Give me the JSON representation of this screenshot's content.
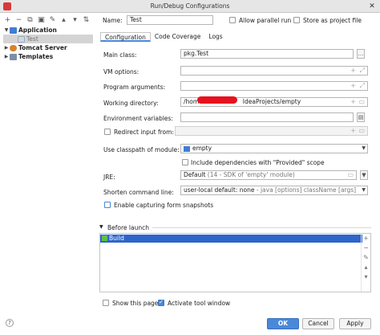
{
  "window": {
    "title": "Run/Debug Configurations"
  },
  "toolbar": {
    "add": "+",
    "remove": "−",
    "copy": "⧉",
    "save": "▣",
    "edit": "✎",
    "move_up": "▴",
    "move_down": "▾",
    "sort": "⇅"
  },
  "tree": {
    "application": "Application",
    "test": "Test",
    "tomcat": "Tomcat Server",
    "templates": "Templates"
  },
  "header": {
    "name_label": "Name:",
    "name_value": "Test",
    "parallel_label": "Allow parallel run",
    "store_label": "Store as project file"
  },
  "tabs": [
    "Configuration",
    "Code Coverage",
    "Logs"
  ],
  "form": {
    "main_class_label": "Main class:",
    "main_class_value": "pkg.Test",
    "vm_options_label": "VM options:",
    "program_args_label": "Program arguments:",
    "working_dir_label": "Working directory:",
    "working_dir_prefix": "/home",
    "working_dir_suffix": "IdeaProjects/empty",
    "env_vars_label": "Environment variables:",
    "redirect_label": "Redirect input from:",
    "classpath_label": "Use classpath of module:",
    "classpath_value": "empty",
    "provided_label": "Include dependencies with \"Provided\" scope",
    "jre_label": "JRE:",
    "jre_value": "Default",
    "jre_detail": "(14 - SDK of 'empty' module)",
    "shorten_label": "Shorten command line:",
    "shorten_value": "user-local default: none",
    "shorten_detail": "- java [options] className [args]",
    "capture_label": "Enable capturing form snapshots"
  },
  "before_launch": {
    "title": "Before launch",
    "items": [
      "Build"
    ]
  },
  "footer": {
    "show_page_label": "Show this page",
    "activate_label": "Activate tool window",
    "ok": "OK",
    "cancel": "Cancel",
    "apply": "Apply",
    "help": "?"
  },
  "colors": {
    "accent": "#4a88da",
    "selection": "#2f65ca",
    "redaction": "#e8111e"
  }
}
